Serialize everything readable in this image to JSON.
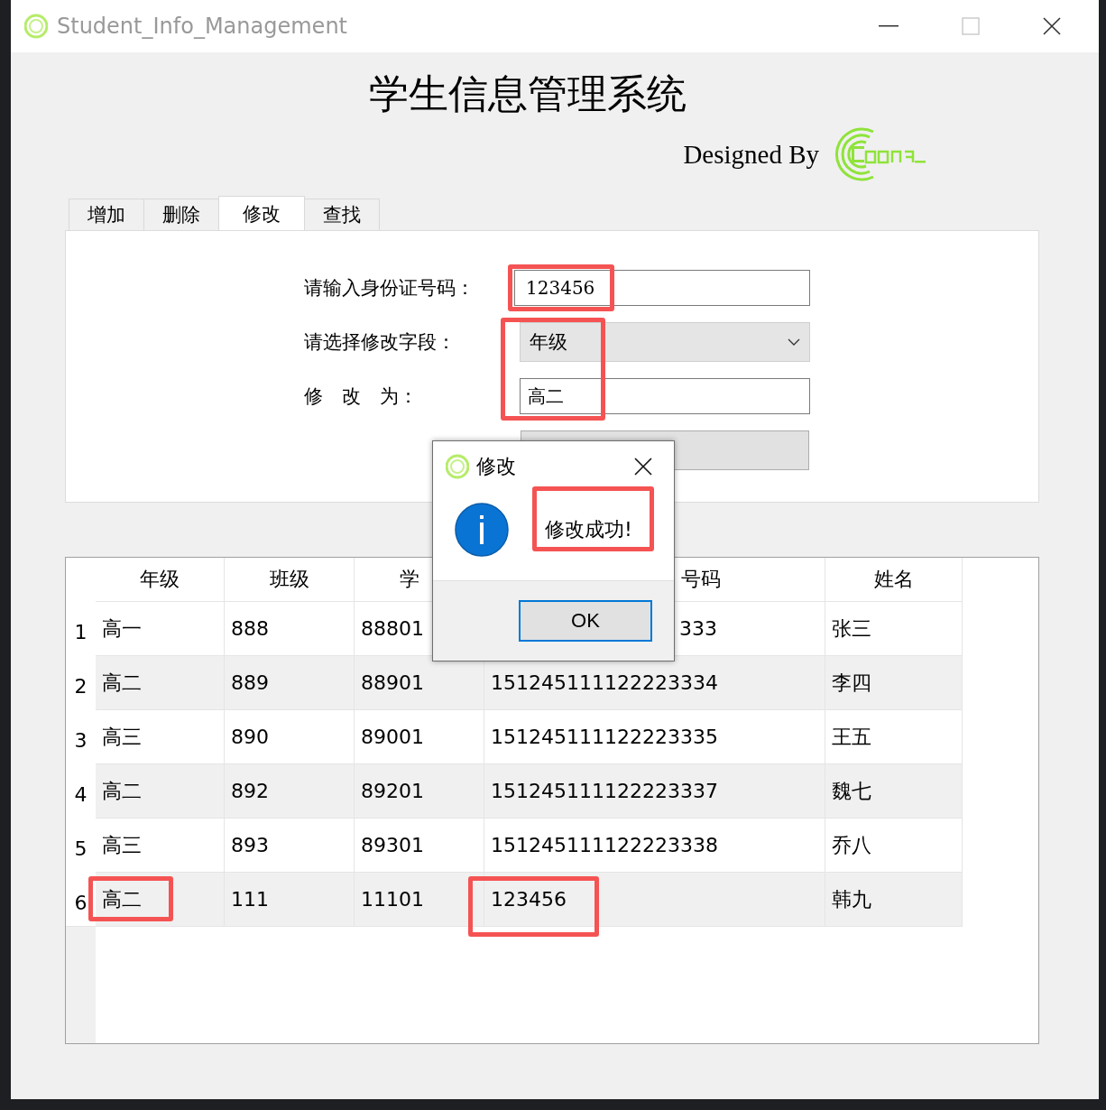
{
  "window": {
    "title": "Student_Info_Management"
  },
  "heading": "学生信息管理系统",
  "credit": "Designed By",
  "tabs": [
    {
      "label": "增加",
      "selected": false
    },
    {
      "label": "删除",
      "selected": false
    },
    {
      "label": "修改",
      "selected": true
    },
    {
      "label": "查找",
      "selected": false
    }
  ],
  "form": {
    "id_label": "请输入身份证号码：",
    "id_value": "123456",
    "id_highlighted": true,
    "field_label": "请选择修改字段：",
    "field_value": "年级",
    "field_highlighted": true,
    "new_label": "修　改　为：",
    "new_value": "高二"
  },
  "table": {
    "columns": [
      "年级",
      "班级",
      "学",
      "号码",
      "姓名"
    ],
    "rows": [
      {
        "header": "1",
        "cells": [
          {
            "text": "高一",
            "highlighted": false
          },
          {
            "text": "888",
            "highlighted": false
          },
          {
            "text": "88801",
            "highlighted": false
          },
          {
            "text": "333",
            "highlighted": false
          },
          {
            "text": "张三",
            "highlighted": false
          }
        ]
      },
      {
        "header": "2",
        "cells": [
          {
            "text": "高二",
            "highlighted": false
          },
          {
            "text": "889",
            "highlighted": false
          },
          {
            "text": "88901",
            "highlighted": false
          },
          {
            "text": "151245111122223334",
            "highlighted": false
          },
          {
            "text": "李四",
            "highlighted": false
          }
        ]
      },
      {
        "header": "3",
        "cells": [
          {
            "text": "高三",
            "highlighted": false
          },
          {
            "text": "890",
            "highlighted": false
          },
          {
            "text": "89001",
            "highlighted": false
          },
          {
            "text": "151245111122223335",
            "highlighted": false
          },
          {
            "text": "王五",
            "highlighted": false
          }
        ]
      },
      {
        "header": "4",
        "cells": [
          {
            "text": "高二",
            "highlighted": false
          },
          {
            "text": "892",
            "highlighted": false
          },
          {
            "text": "89201",
            "highlighted": false
          },
          {
            "text": "151245111122223337",
            "highlighted": false
          },
          {
            "text": "魏七",
            "highlighted": false
          }
        ]
      },
      {
        "header": "5",
        "cells": [
          {
            "text": "高三",
            "highlighted": false
          },
          {
            "text": "893",
            "highlighted": false
          },
          {
            "text": "89301",
            "highlighted": false
          },
          {
            "text": "151245111122223338",
            "highlighted": false
          },
          {
            "text": "乔八",
            "highlighted": false
          }
        ]
      },
      {
        "header": "6",
        "cells": [
          {
            "text": "高二",
            "highlighted": true
          },
          {
            "text": "111",
            "highlighted": false
          },
          {
            "text": "11101",
            "highlighted": false
          },
          {
            "text": "123456",
            "highlighted": true
          },
          {
            "text": "韩九",
            "highlighted": false
          }
        ]
      }
    ]
  },
  "dialog": {
    "title": "修改",
    "message": "修改成功!",
    "message_highlighted": true,
    "button": "OK"
  }
}
